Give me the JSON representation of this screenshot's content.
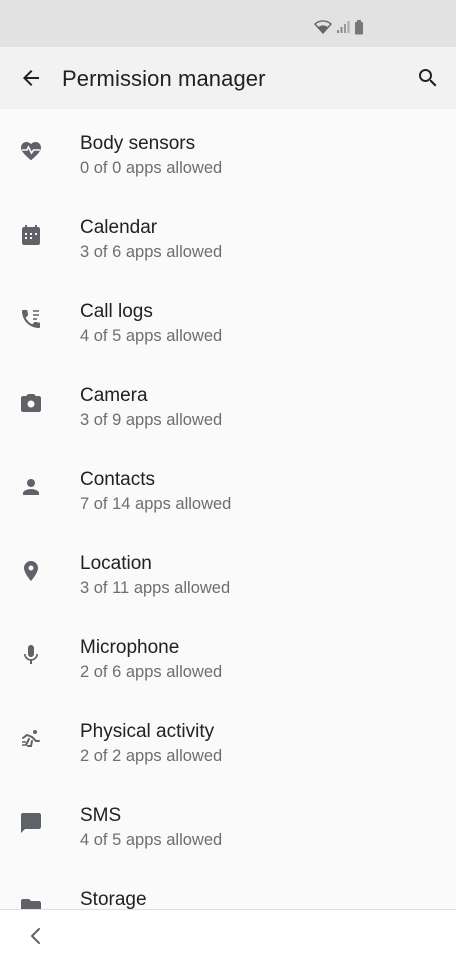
{
  "app_bar": {
    "title": "Permission manager",
    "back_icon": "arrow-back-icon",
    "search_icon": "search-icon"
  },
  "status_bar": {
    "icons": [
      "wifi-icon",
      "signal-icon",
      "battery-icon"
    ]
  },
  "permissions": [
    {
      "label": "Body sensors",
      "summary": "0 of 0 apps allowed",
      "icon": "heart-pulse-icon"
    },
    {
      "label": "Calendar",
      "summary": "3 of 6 apps allowed",
      "icon": "calendar-icon"
    },
    {
      "label": "Call logs",
      "summary": "4 of 5 apps allowed",
      "icon": "call-log-icon"
    },
    {
      "label": "Camera",
      "summary": "3 of 9 apps allowed",
      "icon": "camera-icon"
    },
    {
      "label": "Contacts",
      "summary": "7 of 14 apps allowed",
      "icon": "person-icon"
    },
    {
      "label": "Location",
      "summary": "3 of 11 apps allowed",
      "icon": "location-pin-icon"
    },
    {
      "label": "Microphone",
      "summary": "2 of 6 apps allowed",
      "icon": "microphone-icon"
    },
    {
      "label": "Physical activity",
      "summary": "2 of 2 apps allowed",
      "icon": "running-person-icon"
    },
    {
      "label": "SMS",
      "summary": "4 of 5 apps allowed",
      "icon": "sms-icon"
    },
    {
      "label": "Storage",
      "summary": "",
      "icon": "folder-icon"
    }
  ],
  "nav_bar": {
    "back_icon": "chevron-left-icon"
  },
  "colors": {
    "status_bar_bg": "#e2e2e2",
    "app_bar_bg": "#f2f2f2",
    "page_bg": "#fafafa",
    "icon_color": "#5f6368",
    "title_color": "#202124",
    "subtitle_color": "#6e6e6e"
  }
}
